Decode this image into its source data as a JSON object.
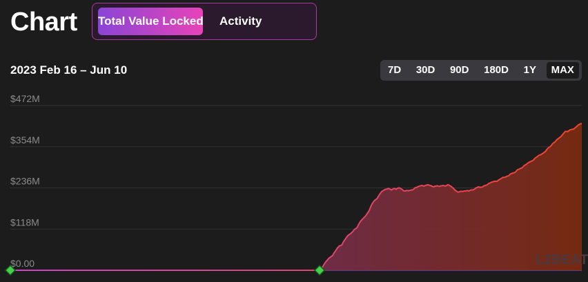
{
  "header": {
    "title": "Chart"
  },
  "tabs": [
    {
      "label": "Total Value Locked",
      "active": true
    },
    {
      "label": "Activity",
      "active": false
    }
  ],
  "range_label": "2023 Feb 16 – Jun 10",
  "periods": [
    {
      "label": "7D",
      "selected": false
    },
    {
      "label": "30D",
      "selected": false
    },
    {
      "label": "90D",
      "selected": false
    },
    {
      "label": "180D",
      "selected": false
    },
    {
      "label": "1Y",
      "selected": false
    },
    {
      "label": "MAX",
      "selected": true
    }
  ],
  "watermark": "L2BEAT",
  "colors": {
    "line_start": "#c847c5",
    "line_end": "#f0452e",
    "fill_start": "#6a2f8a",
    "fill_end": "#7a2a10",
    "marker": "#46d14a",
    "tab_gradient_start": "#8a45d6",
    "tab_gradient_end": "#e843b8"
  },
  "chart_data": {
    "type": "area",
    "title": "",
    "xlabel": "",
    "ylabel": "",
    "y_tick_labels": [
      "$472M",
      "$354M",
      "$236M",
      "$118M",
      "$0.00"
    ],
    "ylim": [
      0,
      472
    ],
    "grid": true,
    "series": [
      {
        "values": [
          0,
          0,
          0,
          0,
          0,
          0,
          0,
          0,
          0,
          0,
          0,
          0,
          0,
          0,
          0,
          0,
          0,
          0,
          0,
          0,
          0,
          0,
          0,
          0,
          0,
          0,
          0,
          0,
          0,
          0,
          0,
          0,
          0,
          0,
          0,
          0,
          0,
          0,
          0,
          0,
          0,
          0,
          0,
          0,
          0,
          0,
          0,
          0,
          0,
          0,
          0,
          0,
          0,
          0,
          0,
          0,
          0,
          0,
          0,
          0,
          0,
          0,
          0,
          0,
          0,
          0,
          0,
          0,
          0,
          0,
          0,
          0,
          0,
          0,
          0,
          0,
          0,
          0,
          0,
          0,
          0,
          0,
          0,
          0,
          0,
          0,
          0,
          0,
          0,
          0,
          0,
          0,
          0,
          0,
          0,
          0,
          0,
          0,
          0,
          0,
          0,
          0,
          0,
          0,
          0,
          0,
          0,
          0,
          0,
          0,
          0,
          0,
          0,
          0,
          0,
          0,
          0,
          0,
          0,
          0,
          0,
          0,
          0,
          0,
          0,
          0,
          0,
          0,
          0,
          0,
          0,
          0,
          0,
          0,
          0,
          0,
          0,
          0,
          0,
          0,
          0,
          0,
          0,
          0,
          0,
          0,
          0,
          0,
          0,
          0,
          0,
          0,
          0,
          0,
          0,
          0,
          0,
          0,
          0,
          0,
          0,
          0,
          0,
          0,
          0,
          0,
          0,
          0,
          0,
          0,
          0,
          0,
          0,
          0,
          0,
          0,
          0,
          0,
          0,
          0,
          0,
          0,
          0,
          0,
          0,
          0,
          0,
          0,
          0,
          0,
          0,
          0,
          0,
          0,
          0,
          0,
          0,
          0,
          0,
          0,
          0,
          0,
          0,
          0,
          0,
          0,
          0,
          0,
          0,
          0,
          0,
          0,
          0,
          0,
          0,
          0,
          0,
          0,
          0,
          0,
          0,
          0,
          0,
          0,
          0,
          0,
          0,
          0,
          0,
          0,
          0,
          0,
          0,
          0,
          0,
          0,
          0,
          0,
          0,
          0,
          0,
          0,
          0,
          0,
          0,
          0,
          0,
          0,
          0,
          0,
          0,
          0,
          0,
          0,
          0,
          0,
          0,
          0,
          0,
          0,
          0,
          0,
          0,
          0,
          2,
          7,
          12,
          18,
          23,
          27,
          31,
          35,
          37,
          40,
          42,
          48,
          53,
          58,
          63,
          67,
          70,
          71,
          73,
          80,
          85,
          90,
          95,
          99,
          102,
          104,
          107,
          110,
          114,
          118,
          120,
          123,
          130,
          136,
          141,
          145,
          148,
          152,
          155,
          160,
          165,
          170,
          178,
          186,
          192,
          197,
          201,
          203,
          206,
          212,
          217,
          222,
          226,
          228,
          230,
          232,
          232,
          234,
          234,
          232,
          230,
          232,
          234,
          234,
          232,
          234,
          236,
          236,
          234,
          232,
          229,
          227,
          227,
          229,
          228,
          228,
          229,
          230,
          230,
          232,
          236,
          237,
          238,
          240,
          241,
          242,
          243,
          242,
          241,
          243,
          244,
          245,
          244,
          243,
          242,
          240,
          239,
          241,
          241,
          242,
          241,
          240,
          242,
          242,
          243,
          242,
          241,
          243,
          245,
          244,
          242,
          240,
          237,
          234,
          230,
          228,
          225,
          224,
          225,
          226,
          226,
          226,
          227,
          227,
          228,
          228,
          227,
          229,
          230,
          230,
          231,
          233,
          236,
          237,
          239,
          238,
          238,
          238,
          240,
          242,
          243,
          244,
          246,
          249,
          250,
          252,
          253,
          254,
          255,
          255,
          255,
          258,
          260,
          262,
          264,
          266,
          266,
          267,
          269,
          270,
          271,
          275,
          277,
          278,
          279,
          280,
          283,
          287,
          289,
          290,
          292,
          293,
          296,
          300,
          302,
          304,
          307,
          309,
          311,
          312,
          314,
          316,
          320,
          323,
          325,
          328,
          330,
          331,
          333,
          335,
          338,
          340,
          345,
          349,
          352,
          354,
          357,
          362,
          365,
          367,
          371,
          375,
          377,
          380,
          382,
          386,
          390,
          394,
          398,
          398,
          397,
          400,
          402,
          403,
          404,
          404,
          407,
          410,
          413,
          416,
          418,
          420,
          420
        ]
      }
    ]
  }
}
